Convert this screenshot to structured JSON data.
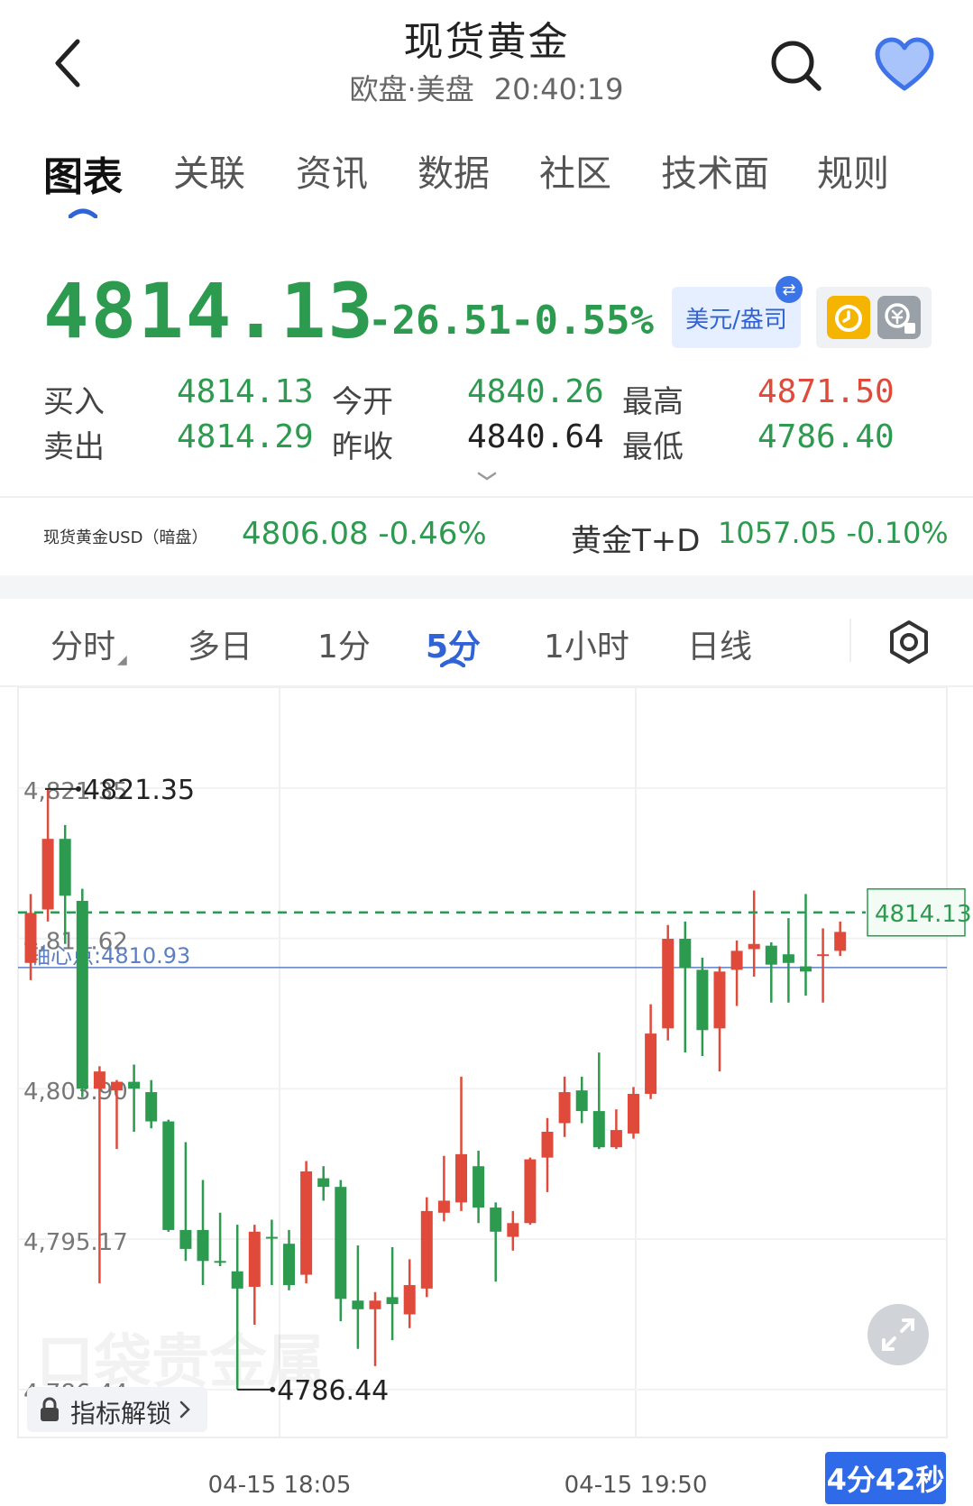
{
  "header": {
    "title": "现货黄金",
    "session": "欧盘·美盘",
    "time": "20:40:19"
  },
  "tabs": [
    {
      "label": "图表",
      "active": true
    },
    {
      "label": "关联"
    },
    {
      "label": "资讯"
    },
    {
      "label": "数据"
    },
    {
      "label": "社区"
    },
    {
      "label": "技术面"
    },
    {
      "label": "规则"
    }
  ],
  "quote": {
    "price": "4814.13",
    "change": "-26.51",
    "change_pct": "-0.55%",
    "unit_button": "美元/盎司",
    "bid_label": "买入",
    "bid": "4814.13",
    "ask_label": "卖出",
    "ask": "4814.29",
    "open_label": "今开",
    "open": "4840.26",
    "prev_close_label": "昨收",
    "prev_close": "4840.64",
    "high_label": "最高",
    "high": "4871.50",
    "low_label": "最低",
    "low": "4786.40"
  },
  "related": {
    "item1_name": "现货黄金USD（暗盘）",
    "item1_value": "4806.08 -0.46%",
    "item2_name": "黄金T+D",
    "item2_value": "1057.05 -0.10%"
  },
  "periods": [
    {
      "label": "分时",
      "caret": true
    },
    {
      "label": "多日"
    },
    {
      "label": "1分"
    },
    {
      "label": "5分",
      "active": true
    },
    {
      "label": "1小时"
    },
    {
      "label": "日线"
    }
  ],
  "chart_data": {
    "type": "candlestick",
    "title": "",
    "ylim": [
      4783.5,
      4826.0
    ],
    "y_ticks": [
      "4,821.35",
      "4,812.62",
      "4,803.90",
      "4,795.17",
      "4,786.44"
    ],
    "y_tick_values": [
      4821.35,
      4812.62,
      4803.9,
      4795.17,
      4786.44
    ],
    "x_ticks": [
      "04-15 18:05",
      "04-15 19:50"
    ],
    "max_label": "4821.35",
    "min_label": "4786.44",
    "last_price_label": "4814.13",
    "last_price": 4814.13,
    "pivot_label": "轴心点:4810.93",
    "pivot": 4810.93,
    "grid": true,
    "colors": {
      "up": "#e04a3a",
      "down": "#2c9a4f",
      "pivot": "#5b7fc4",
      "last": "#2c9a4f"
    },
    "candles": [
      {
        "o": 4811.2,
        "c": 4814.1,
        "h": 4815.2,
        "l": 4810.2
      },
      {
        "o": 4814.3,
        "c": 4818.4,
        "h": 4821.35,
        "l": 4813.6
      },
      {
        "o": 4818.4,
        "c": 4815.1,
        "h": 4819.2,
        "l": 4812.3
      },
      {
        "o": 4814.8,
        "c": 4803.9,
        "h": 4815.5,
        "l": 4803.4
      },
      {
        "o": 4803.9,
        "c": 4804.9,
        "h": 4805.2,
        "l": 4792.6
      },
      {
        "o": 4803.8,
        "c": 4804.3,
        "h": 4804.4,
        "l": 4800.4
      },
      {
        "o": 4804.3,
        "c": 4803.9,
        "h": 4805.3,
        "l": 4801.4
      },
      {
        "o": 4803.7,
        "c": 4802.0,
        "h": 4804.4,
        "l": 4801.6
      },
      {
        "o": 4802.0,
        "c": 4795.7,
        "h": 4802.1,
        "l": 4795.6
      },
      {
        "o": 4795.7,
        "c": 4794.6,
        "h": 4800.8,
        "l": 4793.9
      },
      {
        "o": 4795.7,
        "c": 4793.9,
        "h": 4798.6,
        "l": 4792.5
      },
      {
        "o": 4793.9,
        "c": 4793.8,
        "h": 4796.7,
        "l": 4793.6
      },
      {
        "o": 4793.3,
        "c": 4792.3,
        "h": 4796.0,
        "l": 4786.44
      },
      {
        "o": 4792.4,
        "c": 4795.6,
        "h": 4796.0,
        "l": 4790.2
      },
      {
        "o": 4795.3,
        "c": 4795.2,
        "h": 4796.3,
        "l": 4792.5
      },
      {
        "o": 4794.9,
        "c": 4792.5,
        "h": 4795.7,
        "l": 4792.2
      },
      {
        "o": 4793.1,
        "c": 4799.1,
        "h": 4799.7,
        "l": 4792.6
      },
      {
        "o": 4798.7,
        "c": 4798.2,
        "h": 4799.4,
        "l": 4797.4
      },
      {
        "o": 4798.2,
        "c": 4791.7,
        "h": 4798.6,
        "l": 4790.4
      },
      {
        "o": 4791.6,
        "c": 4791.1,
        "h": 4794.8,
        "l": 4788.8
      },
      {
        "o": 4791.1,
        "c": 4791.6,
        "h": 4792.1,
        "l": 4787.8
      },
      {
        "o": 4791.8,
        "c": 4791.4,
        "h": 4794.7,
        "l": 4789.3
      },
      {
        "o": 4790.8,
        "c": 4792.5,
        "h": 4794.0,
        "l": 4790.0
      },
      {
        "o": 4792.3,
        "c": 4796.8,
        "h": 4797.6,
        "l": 4791.8
      },
      {
        "o": 4796.7,
        "c": 4797.4,
        "h": 4800.0,
        "l": 4796.2
      },
      {
        "o": 4797.3,
        "c": 4800.1,
        "h": 4804.6,
        "l": 4796.8
      },
      {
        "o": 4799.4,
        "c": 4797.0,
        "h": 4800.3,
        "l": 4796.1
      },
      {
        "o": 4797.0,
        "c": 4795.6,
        "h": 4797.3,
        "l": 4792.7
      },
      {
        "o": 4795.3,
        "c": 4796.1,
        "h": 4796.8,
        "l": 4794.5
      },
      {
        "o": 4796.1,
        "c": 4799.8,
        "h": 4799.9,
        "l": 4796.0
      },
      {
        "o": 4799.9,
        "c": 4801.4,
        "h": 4802.2,
        "l": 4797.9
      },
      {
        "o": 4801.9,
        "c": 4803.7,
        "h": 4804.6,
        "l": 4801.1
      },
      {
        "o": 4803.8,
        "c": 4802.6,
        "h": 4804.6,
        "l": 4801.9
      },
      {
        "o": 4802.6,
        "c": 4800.5,
        "h": 4806.0,
        "l": 4800.4
      },
      {
        "o": 4800.5,
        "c": 4801.5,
        "h": 4802.7,
        "l": 4800.4
      },
      {
        "o": 4801.3,
        "c": 4803.6,
        "h": 4804.0,
        "l": 4801.0
      },
      {
        "o": 4803.6,
        "c": 4807.1,
        "h": 4808.8,
        "l": 4803.3
      },
      {
        "o": 4807.4,
        "c": 4812.6,
        "h": 4813.4,
        "l": 4806.7
      },
      {
        "o": 4812.6,
        "c": 4810.9,
        "h": 4813.6,
        "l": 4806.0
      },
      {
        "o": 4810.8,
        "c": 4807.3,
        "h": 4811.5,
        "l": 4805.8
      },
      {
        "o": 4807.4,
        "c": 4810.7,
        "h": 4811.0,
        "l": 4804.9
      },
      {
        "o": 4810.8,
        "c": 4811.9,
        "h": 4812.5,
        "l": 4808.7
      },
      {
        "o": 4812.0,
        "c": 4812.3,
        "h": 4815.4,
        "l": 4810.4
      },
      {
        "o": 4812.2,
        "c": 4811.1,
        "h": 4812.4,
        "l": 4808.9
      },
      {
        "o": 4811.7,
        "c": 4811.2,
        "h": 4813.8,
        "l": 4808.9
      },
      {
        "o": 4811.0,
        "c": 4810.7,
        "h": 4815.2,
        "l": 4809.3
      },
      {
        "o": 4811.7,
        "c": 4811.7,
        "h": 4813.2,
        "l": 4808.9
      },
      {
        "o": 4811.9,
        "c": 4813.0,
        "h": 4813.6,
        "l": 4811.6
      }
    ]
  },
  "lock_button": "指标解锁",
  "timer": "4分42秒"
}
